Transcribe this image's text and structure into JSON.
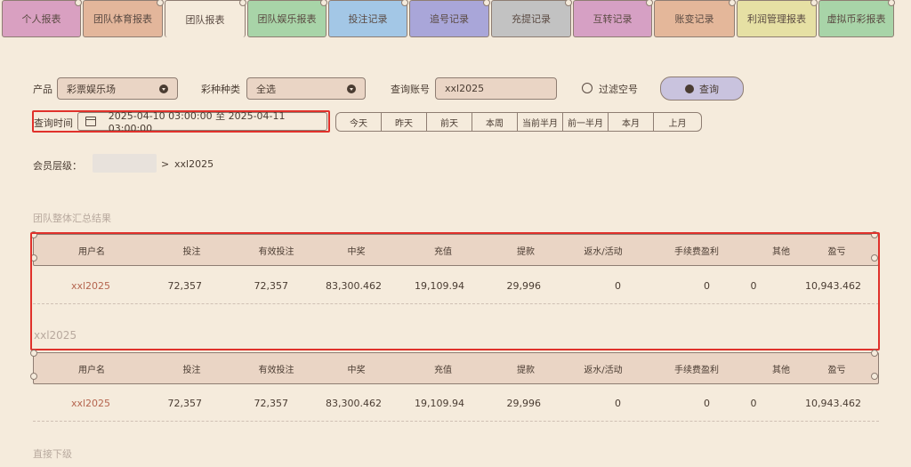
{
  "tabs": [
    {
      "label": "个人报表",
      "color": "#d9a0c1"
    },
    {
      "label": "团队体育报表",
      "color": "#e3b69b"
    },
    {
      "label": "团队报表",
      "color": "#f5ebdc",
      "active": true
    },
    {
      "label": "团队娱乐报表",
      "color": "#a8d4a8"
    },
    {
      "label": "投注记录",
      "color": "#a3c7e6"
    },
    {
      "label": "追号记录",
      "color": "#a9a6d9"
    },
    {
      "label": "充提记录",
      "color": "#c2c2c2"
    },
    {
      "label": "互转记录",
      "color": "#d6a0c4"
    },
    {
      "label": "账变记录",
      "color": "#e4b79a"
    },
    {
      "label": "利润管理报表",
      "color": "#e6e0a4"
    },
    {
      "label": "虚拟币彩报表",
      "color": "#a8d4a8"
    }
  ],
  "filters": {
    "product_label": "产品",
    "product_value": "彩票娱乐场",
    "lottery_type_label": "彩种种类",
    "lottery_type_value": "全选",
    "account_label": "查询账号",
    "account_value": "xxl2025",
    "filter_empty_label": "过滤空号",
    "query_button": "查询",
    "time_label": "查询时间",
    "time_range": "2025-04-10 03:00:00 至 2025-04-11 03:00:00",
    "quick_ranges": [
      "今天",
      "昨天",
      "前天",
      "本周",
      "当前半月",
      "前一半月",
      "本月",
      "上月"
    ]
  },
  "member_level": {
    "label": "会员层级：",
    "separator": ">",
    "user": "xxl2025"
  },
  "summary": {
    "title": "团队整体汇总结果",
    "headers": [
      "用户名",
      "投注",
      "有效投注",
      "中奖",
      "充值",
      "提款",
      "返水/活动",
      "手续费盈利",
      "其他",
      "盈亏"
    ],
    "row": [
      "xxl2025",
      "72,357",
      "72,357",
      "83,300.462",
      "19,109.94",
      "29,996",
      "0",
      "0",
      "0",
      "10,943.462"
    ]
  },
  "user_section": {
    "title": "xxl2025",
    "headers": [
      "用户名",
      "投注",
      "有效投注",
      "中奖",
      "充值",
      "提款",
      "返水/活动",
      "手续费盈利",
      "其他",
      "盈亏"
    ],
    "row": [
      "xxl2025",
      "72,357",
      "72,357",
      "83,300.462",
      "19,109.94",
      "29,996",
      "0",
      "0",
      "0",
      "10,943.462"
    ]
  },
  "subordinates": {
    "title": "直接下级"
  }
}
